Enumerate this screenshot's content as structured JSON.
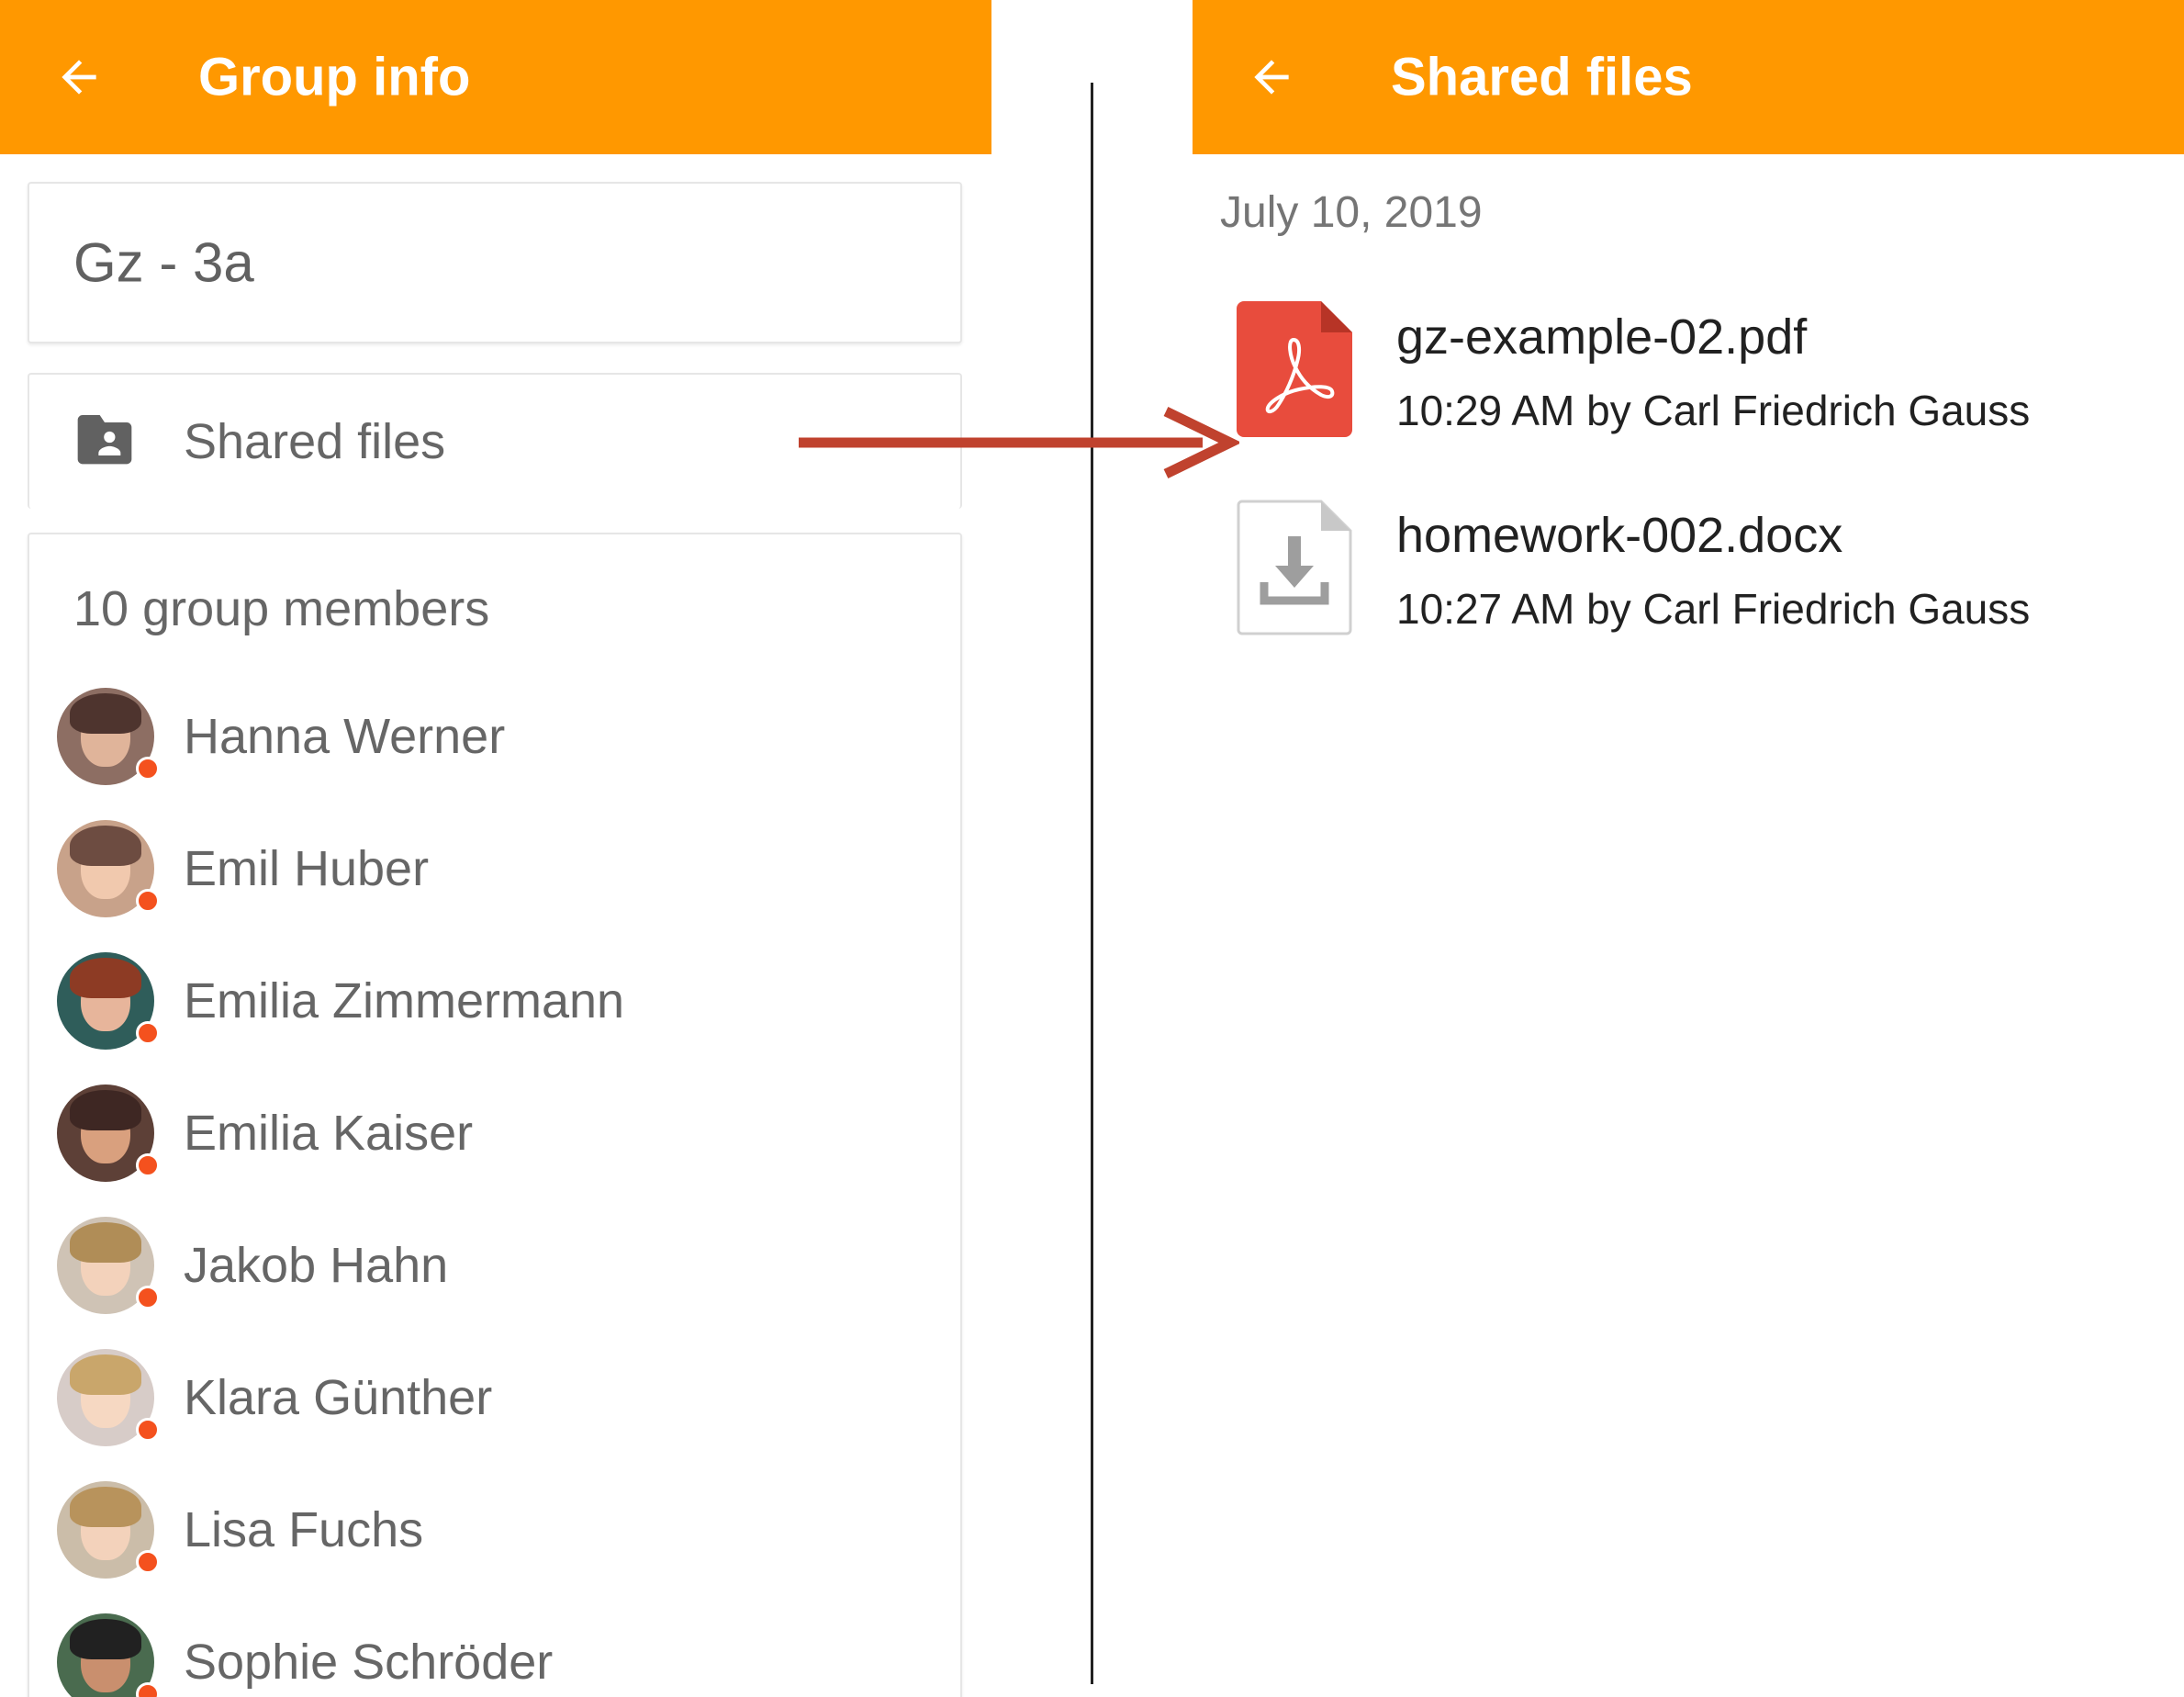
{
  "left_screen": {
    "appbar": {
      "title": "Group info",
      "back_icon": "arrow-back-icon",
      "color": "#FF9800"
    },
    "group_name": "Gz - 3a",
    "shared_files_row": {
      "icon": "folder-shared-icon",
      "label": "Shared files"
    },
    "members": {
      "title": "10 group members",
      "items": [
        {
          "name": "Hanna Werner",
          "status_color": "#F4511E"
        },
        {
          "name": "Emil Huber",
          "status_color": "#F4511E"
        },
        {
          "name": "Emilia Zimmermann",
          "status_color": "#F4511E"
        },
        {
          "name": "Emilia Kaiser",
          "status_color": "#F4511E"
        },
        {
          "name": "Jakob Hahn",
          "status_color": "#F4511E"
        },
        {
          "name": "Klara Günther",
          "status_color": "#F4511E"
        },
        {
          "name": "Lisa Fuchs",
          "status_color": "#F4511E"
        },
        {
          "name": "Sophie Schröder",
          "status_color": "#F4511E"
        }
      ]
    }
  },
  "right_screen": {
    "appbar": {
      "title": "Shared files",
      "back_icon": "arrow-back-icon",
      "color": "#FF9800"
    },
    "date_header": "July 10, 2019",
    "files": [
      {
        "name": "gz-example-02.pdf",
        "meta": "10:29 AM by Carl Friedrich Gauss",
        "icon": "pdf-file-icon"
      },
      {
        "name": "homework-002.docx",
        "meta": "10:27 AM by Carl Friedrich Gauss",
        "icon": "download-file-icon"
      }
    ]
  },
  "annotation": {
    "arrow_color": "#C0422E"
  }
}
